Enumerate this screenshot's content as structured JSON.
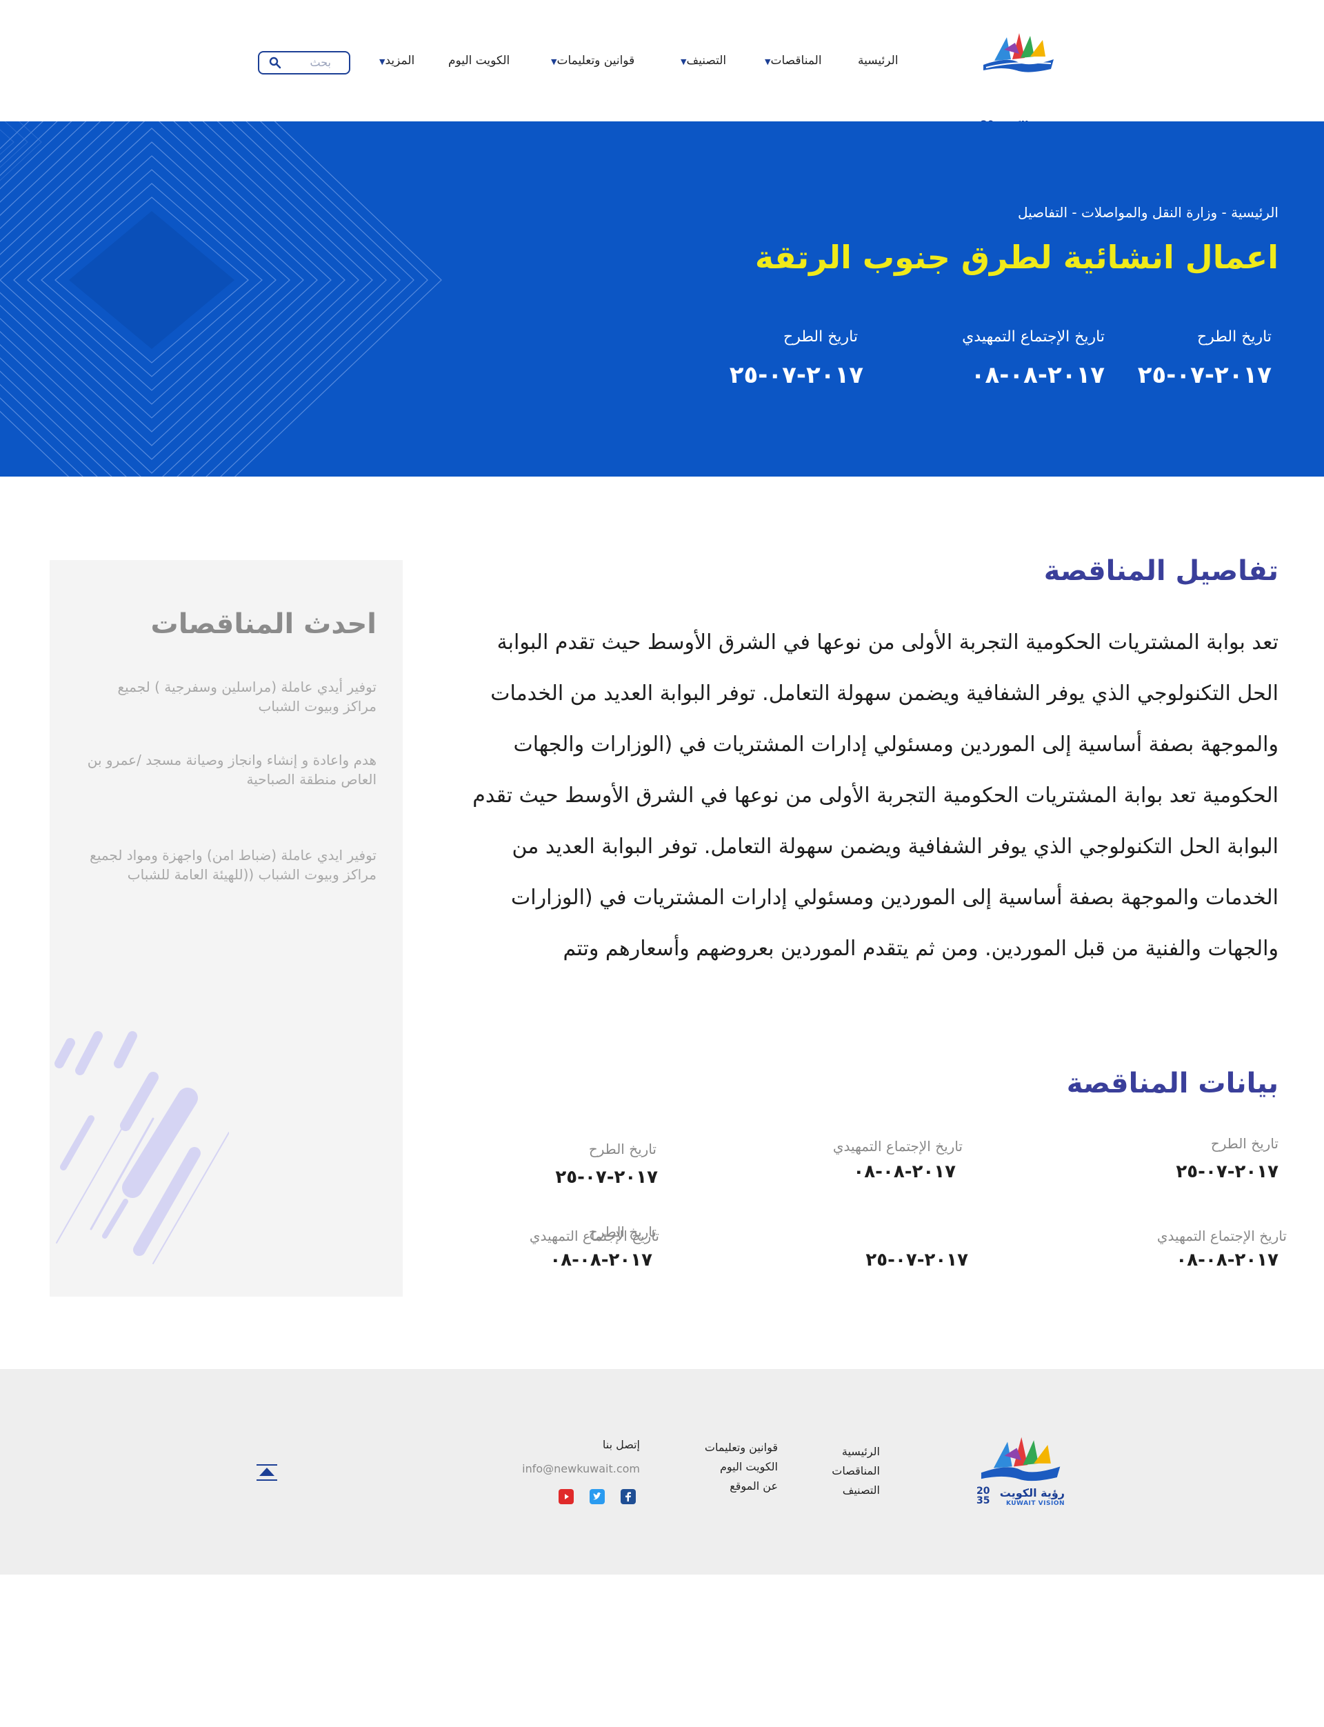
{
  "header": {
    "logo": {
      "text_ar": "رؤية الكويت",
      "text_en": "KUWAIT VISION",
      "year_top": "20",
      "year_bottom": "35"
    },
    "nav": [
      {
        "label": "الرئيسية",
        "has_dropdown": false
      },
      {
        "label": "المناقصات",
        "has_dropdown": true
      },
      {
        "label": "التصنيف",
        "has_dropdown": true
      },
      {
        "label": "قوانين وتعليمات",
        "has_dropdown": true
      },
      {
        "label": "الكويت اليوم",
        "has_dropdown": false
      },
      {
        "label": "المزيد",
        "has_dropdown": true
      }
    ],
    "search": {
      "placeholder": "بحث"
    }
  },
  "hero": {
    "breadcrumb": "الرئيسية - وزارة النقل والمواصلات - التفاصيل",
    "title": "اعمال انشائية لطرق جنوب الرتقة",
    "dates": [
      {
        "label": "تاريخ الطرح",
        "value": "٢٠١٧-٠٧-٢٥"
      },
      {
        "label": "تاريخ الإجتماع التمهيدي",
        "value": "٢٠١٧-٠٨-٠٨"
      },
      {
        "label": "تاريخ الطرح",
        "value": "٢٠١٧-٠٧-٢٥"
      }
    ]
  },
  "details": {
    "title": "تفاصيل المناقصة",
    "text": "تعد بوابة المشتريات الحكومية التجربة الأولى من نوعها في الشرق الأوسط حيث تقدم البوابة الحل التكنولوجي الذي يوفر الشفافية ويضمن سهولة التعامل. توفر البوابة العديد من الخدمات والموجهة بصفة أساسية إلى الموردين ومسئولي إدارات المشتريات في (الوزارات والجهات الحكومية تعد بوابة المشتريات الحكومية التجربة الأولى من نوعها في الشرق الأوسط حيث تقدم البوابة الحل التكنولوجي الذي يوفر الشفافية ويضمن سهولة التعامل. توفر البوابة العديد من الخدمات والموجهة بصفة أساسية إلى الموردين ومسئولي إدارات المشتريات في (الوزارات والجهات والفنية من قبل الموردين. ومن ثم يتقدم الموردين بعروضهم وأسعارهم وتتم"
  },
  "tender_data": {
    "title": "بيانات المناقصة",
    "row1": [
      {
        "label": "تاريخ الطرح",
        "value": "٢٠١٧-٠٧-٢٥"
      },
      {
        "label": "تاريخ الإجتماع التمهيدي",
        "value": "٢٠١٧-٠٨-٠٨"
      },
      {
        "label": "تاريخ الطرح",
        "value": "٢٠١٧-٠٧-٢٥"
      }
    ],
    "row2": [
      {
        "label": "تاريخ الإجتماع التمهيدي",
        "value": "٢٠١٧-٠٨-٠٨"
      },
      {
        "label": "تاريخ الطرح",
        "value": "٢٠١٧-٠٧-٢٥"
      },
      {
        "label": "تاريخ الإجتماع التمهيدي",
        "value": "٢٠١٧-٠٨-٠٨"
      }
    ]
  },
  "sidebar": {
    "title": "احدث المناقصات",
    "items": [
      "توفير أيدي عاملة (مراسلين وسفرجية ) لجميع مراكز وبيوت الشباب",
      "هدم واعادة و إنشاء وانجاز وصيانة مسجد /عمرو بن العاص منطقة الصباحية",
      "توفير ايدي عاملة (ضباط امن) واجهزة ومواد لجميع مراكز وبيوت الشباب ((للهيئة العامة للشباب"
    ]
  },
  "footer": {
    "col1": [
      "الرئيسية",
      "المناقصات",
      "التصنيف"
    ],
    "col2": [
      "قوانين وتعليمات",
      "الكويت اليوم",
      "عن الموقع"
    ],
    "contact_title": "إتصل بنا",
    "email": "info@newkuwait.com",
    "social": [
      "facebook-icon",
      "twitter-icon",
      "youtube-icon"
    ]
  },
  "colors": {
    "primary": "#0c56c5",
    "accent": "#f0ea1a",
    "heading": "#3a3f9a",
    "footer_bg": "#eeeeee"
  }
}
